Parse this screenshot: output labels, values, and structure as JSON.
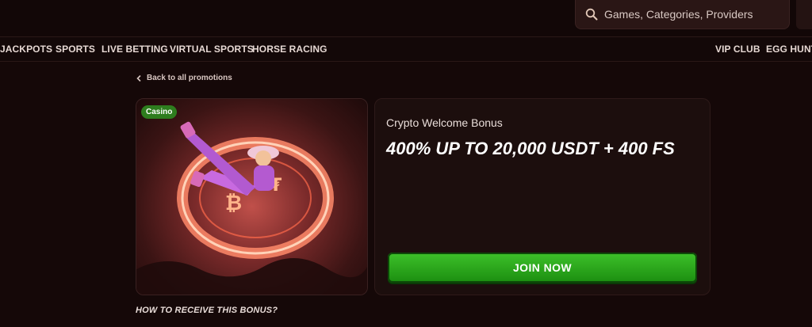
{
  "search": {
    "placeholder": "Games, Categories, Providers",
    "icon": "search-icon"
  },
  "nav": {
    "left_items": [
      "JACKPOTS",
      "SPORTS",
      "LIVE BETTING",
      "VIRTUAL SPORTS",
      "HORSE RACING"
    ],
    "right_items": [
      "VIP CLUB",
      "EGG HUNT"
    ]
  },
  "back_link": {
    "label": "Back to all promotions",
    "icon": "chevron-left-icon"
  },
  "promo": {
    "badge": "Casino",
    "subtitle": "Crypto Welcome Bonus",
    "headline": "400% UP TO 20,000 USDT + 400 FS",
    "cta": "JOIN NOW"
  },
  "section": {
    "howto_title": "HOW TO RECEIVE THIS BONUS?"
  },
  "colors": {
    "cta_green": "#2fae1f",
    "badge_green": "#2e7d1e",
    "bg": "#150808"
  }
}
